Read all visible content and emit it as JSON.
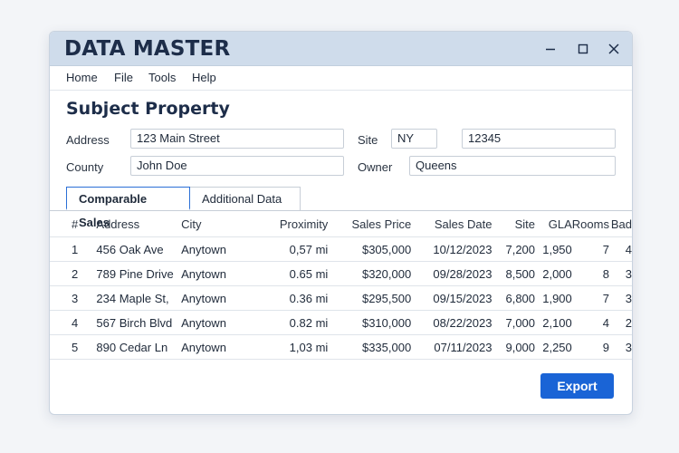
{
  "window": {
    "title": "DATA MASTER",
    "controls": {
      "minimize": "minimize-icon",
      "maximize": "maximize-icon",
      "close": "close-icon"
    }
  },
  "menu": [
    "Home",
    "File",
    "Tools",
    "Help"
  ],
  "subject": {
    "heading": "Subject Property",
    "address_label": "Address",
    "address_value": "123 Main Street",
    "site_label": "Site",
    "site_state": "NY",
    "site_zip": "12345",
    "county_label": "County",
    "county_value": "John Doe",
    "owner_label": "Owner",
    "owner_value": "Queens"
  },
  "tabs": [
    {
      "label": "Comparable Sales",
      "active": true
    },
    {
      "label": "Additional Data",
      "active": false
    }
  ],
  "table": {
    "headers": [
      "#",
      "Address",
      "City",
      "Proximity",
      "Sales Price",
      "Sales Date",
      "Site",
      "GLA",
      "Rooms",
      "Bad"
    ],
    "rows": [
      [
        "1",
        "456 Oak Ave",
        "Anytown",
        "0,57 mi",
        "$305,000",
        "10/12/2023",
        "7,200",
        "1,950",
        "7",
        "4"
      ],
      [
        "2",
        "789 Pine Drive",
        "Anytown",
        "0.65 mi",
        "$320,000",
        "09/28/2023",
        "8,500",
        "2,000",
        "8",
        "3"
      ],
      [
        "3",
        "234 Maple St,",
        "Anytown",
        "0.36 mi",
        "$295,500",
        "09/15/2023",
        "6,800",
        "1,900",
        "7",
        "3"
      ],
      [
        "4",
        "567 Birch Blvd",
        "Anytown",
        "0.82 mi",
        "$310,000",
        "08/22/2023",
        "7,000",
        "2,100",
        "4",
        "2"
      ],
      [
        "5",
        "890 Cedar Ln",
        "Anytown",
        "1,03 mi",
        "$335,000",
        "07/11/2023",
        "9,000",
        "2,250",
        "9",
        "3"
      ]
    ]
  },
  "actions": {
    "export_label": "Export"
  },
  "colors": {
    "accent": "#1a64d6",
    "titlebar": "#cfdceb",
    "title_text": "#1d2d49"
  }
}
